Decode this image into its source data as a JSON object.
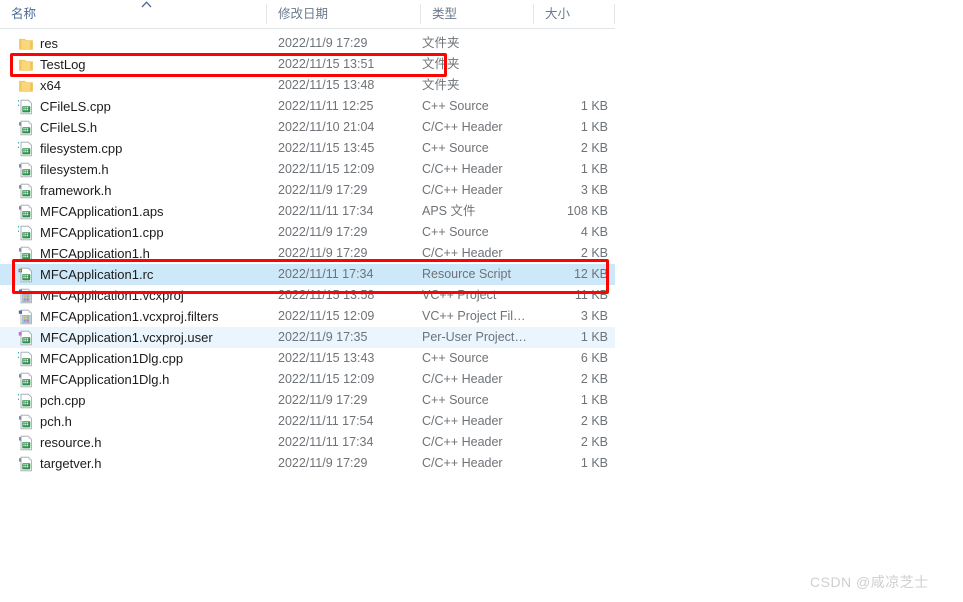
{
  "window": {
    "kind": "file-explorer-list-view"
  },
  "header": {
    "columns": [
      {
        "label": "名称",
        "key": "name",
        "sorted": true,
        "sort_dir": "asc"
      },
      {
        "label": "修改日期",
        "key": "date",
        "sorted": false,
        "sort_dir": ""
      },
      {
        "label": "类型",
        "key": "type",
        "sorted": false,
        "sort_dir": ""
      },
      {
        "label": "大小",
        "key": "size",
        "sorted": false,
        "sort_dir": ""
      }
    ],
    "sort_icon": "sort-ascending-caret-icon"
  },
  "rows": [
    {
      "name": "res",
      "date": "2022/11/9 17:29",
      "type": "文件夹",
      "size": "",
      "icon": "folder-icon",
      "state": "normal"
    },
    {
      "name": "TestLog",
      "date": "2022/11/15 13:51",
      "type": "文件夹",
      "size": "",
      "icon": "folder-icon",
      "state": "normal"
    },
    {
      "name": "x64",
      "date": "2022/11/15 13:48",
      "type": "文件夹",
      "size": "",
      "icon": "folder-icon",
      "state": "normal"
    },
    {
      "name": "CFileLS.cpp",
      "date": "2022/11/11 12:25",
      "type": "C++ Source",
      "size": "1 KB",
      "icon": "cpp-source-icon",
      "state": "normal"
    },
    {
      "name": "CFileLS.h",
      "date": "2022/11/10 21:04",
      "type": "C/C++ Header",
      "size": "1 KB",
      "icon": "cpp-header-icon",
      "state": "normal"
    },
    {
      "name": "filesystem.cpp",
      "date": "2022/11/15 13:45",
      "type": "C++ Source",
      "size": "2 KB",
      "icon": "cpp-source-icon",
      "state": "normal"
    },
    {
      "name": "filesystem.h",
      "date": "2022/11/15 12:09",
      "type": "C/C++ Header",
      "size": "1 KB",
      "icon": "cpp-header-icon",
      "state": "normal"
    },
    {
      "name": "framework.h",
      "date": "2022/11/9 17:29",
      "type": "C/C++ Header",
      "size": "3 KB",
      "icon": "cpp-header-icon",
      "state": "normal"
    },
    {
      "name": "MFCApplication1.aps",
      "date": "2022/11/11 17:34",
      "type": "APS 文件",
      "size": "108 KB",
      "icon": "cpp-header-icon",
      "state": "normal"
    },
    {
      "name": "MFCApplication1.cpp",
      "date": "2022/11/9 17:29",
      "type": "C++ Source",
      "size": "4 KB",
      "icon": "cpp-source-icon",
      "state": "normal"
    },
    {
      "name": "MFCApplication1.h",
      "date": "2022/11/9 17:29",
      "type": "C/C++ Header",
      "size": "2 KB",
      "icon": "cpp-header-icon",
      "state": "normal"
    },
    {
      "name": "MFCApplication1.rc",
      "date": "2022/11/11 17:34",
      "type": "Resource Script",
      "size": "12 KB",
      "icon": "resource-script-icon",
      "state": "selected"
    },
    {
      "name": "MFCApplication1.vcxproj",
      "date": "2022/11/15 13:58",
      "type": "VC++ Project",
      "size": "11 KB",
      "icon": "vcxproj-icon",
      "state": "normal"
    },
    {
      "name": "MFCApplication1.vcxproj.filters",
      "date": "2022/11/15 12:09",
      "type": "VC++ Project Fil…",
      "size": "3 KB",
      "icon": "vcxproj-icon",
      "state": "normal"
    },
    {
      "name": "MFCApplication1.vcxproj.user",
      "date": "2022/11/9 17:35",
      "type": "Per-User Project…",
      "size": "1 KB",
      "icon": "vcxproj-user-icon",
      "state": "hover"
    },
    {
      "name": "MFCApplication1Dlg.cpp",
      "date": "2022/11/15 13:43",
      "type": "C++ Source",
      "size": "6 KB",
      "icon": "cpp-source-icon",
      "state": "normal"
    },
    {
      "name": "MFCApplication1Dlg.h",
      "date": "2022/11/15 12:09",
      "type": "C/C++ Header",
      "size": "2 KB",
      "icon": "cpp-header-icon",
      "state": "normal"
    },
    {
      "name": "pch.cpp",
      "date": "2022/11/9 17:29",
      "type": "C++ Source",
      "size": "1 KB",
      "icon": "cpp-source-icon",
      "state": "normal"
    },
    {
      "name": "pch.h",
      "date": "2022/11/11 17:54",
      "type": "C/C++ Header",
      "size": "2 KB",
      "icon": "cpp-header-icon",
      "state": "normal"
    },
    {
      "name": "resource.h",
      "date": "2022/11/11 17:34",
      "type": "C/C++ Header",
      "size": "2 KB",
      "icon": "cpp-header-icon",
      "state": "normal"
    },
    {
      "name": "targetver.h",
      "date": "2022/11/9 17:29",
      "type": "C/C++ Header",
      "size": "1 KB",
      "icon": "cpp-header-icon",
      "state": "normal"
    }
  ],
  "annotations": [
    {
      "id": "redbox-testlog",
      "target_row": "TestLog",
      "color": "#fb0404",
      "shape": "rectangle"
    },
    {
      "id": "redbox-rc",
      "target_row": "MFCApplication1.rc",
      "color": "#fb0404",
      "shape": "rectangle"
    }
  ],
  "watermark": {
    "text": "CSDN @咸凉芝士",
    "color": "#cfcfcf"
  },
  "colors": {
    "selection_blue": "#cce8f9",
    "hover_blue": "#eaf5fd",
    "header_text": "#6b7a8d",
    "header_text_sorted": "#4a6b96",
    "name_text": "#1c1c1c",
    "meta_text": "#6e7378",
    "annotation_red": "#fb0404",
    "divider": "#e4e7ea",
    "folder_gold": "#fcd77f"
  }
}
